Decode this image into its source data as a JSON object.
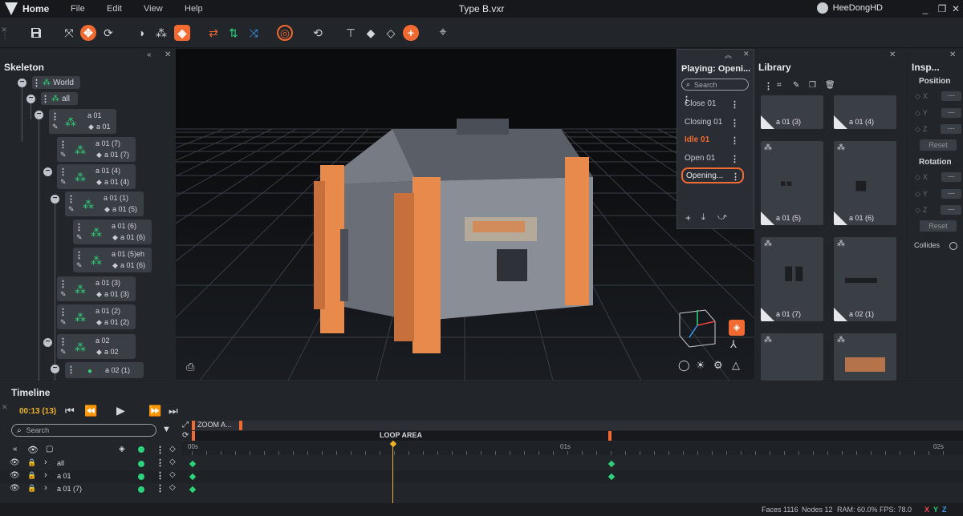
{
  "titlebar": {
    "home": "Home",
    "menus": [
      "File",
      "Edit",
      "View",
      "Help"
    ],
    "filename": "Type B.vxr",
    "username": "HeeDongHD",
    "minimize": "_",
    "maximize": "❐",
    "close": "✕"
  },
  "skeleton": {
    "title": "Skeleton",
    "world": "World",
    "all": "all",
    "nodes": [
      {
        "name": "a 01",
        "mesh": "a 01"
      },
      {
        "name": "a 01 (7)",
        "mesh": "a 01 (7)"
      },
      {
        "name": "a 01 (4)",
        "mesh": "a 01 (4)"
      },
      {
        "name": "a 01 (1)",
        "mesh": "a 01 (5)"
      },
      {
        "name": "a 01 (6)",
        "mesh": "a 01 (6)"
      },
      {
        "name": "a 01 (5)eh",
        "mesh": "a 01 (6)"
      },
      {
        "name": "a 01 (3)",
        "mesh": "a 01 (3)"
      },
      {
        "name": "a 01 (2)",
        "mesh": "a 01 (2)"
      },
      {
        "name": "a 02",
        "mesh": "a 02"
      },
      {
        "name": "",
        "mesh": "a 02 (1)"
      }
    ]
  },
  "animations": {
    "title": "Playing: Openi...",
    "search_placeholder": "Search",
    "items": [
      "Close 01",
      "Closing 01",
      "Idle 01",
      "Open 01",
      "Opening..."
    ],
    "active_index": 2,
    "selected_index": 4
  },
  "library": {
    "title": "Library",
    "items": [
      "a 01 (3)",
      "a 01 (4)",
      "a 01 (5)",
      "a 01 (6)",
      "a 01 (7)",
      "a 02 (1)",
      "",
      ""
    ]
  },
  "inspector": {
    "title": "Insp...",
    "position": "Position",
    "rotation": "Rotation",
    "axes": [
      "X",
      "Y",
      "Z"
    ],
    "field_value": "---",
    "reset": "Reset",
    "collides": "Collides"
  },
  "timeline": {
    "title": "Timeline",
    "time": "00:13 (13)",
    "search_placeholder": "Search",
    "zoom_area": "ZOOM A...",
    "loop_area": "LOOP AREA",
    "ticks": [
      "00s",
      "01s",
      "02s"
    ],
    "tracks": [
      "all",
      "a 01",
      "a 01 (7)"
    ]
  },
  "status": {
    "faces": "Faces 1116",
    "nodes": "Nodes 12",
    "ram": "RAM: 60.0%",
    "fps": "FPS: 78.0",
    "x": "X",
    "y": "Y",
    "z": "Z"
  },
  "colors": {
    "accent": "#f06a32",
    "green": "#2ed27a",
    "panel": "#22252a",
    "axis_x": "#f04848",
    "axis_y": "#2ed27a",
    "axis_z": "#3a9cf0"
  }
}
